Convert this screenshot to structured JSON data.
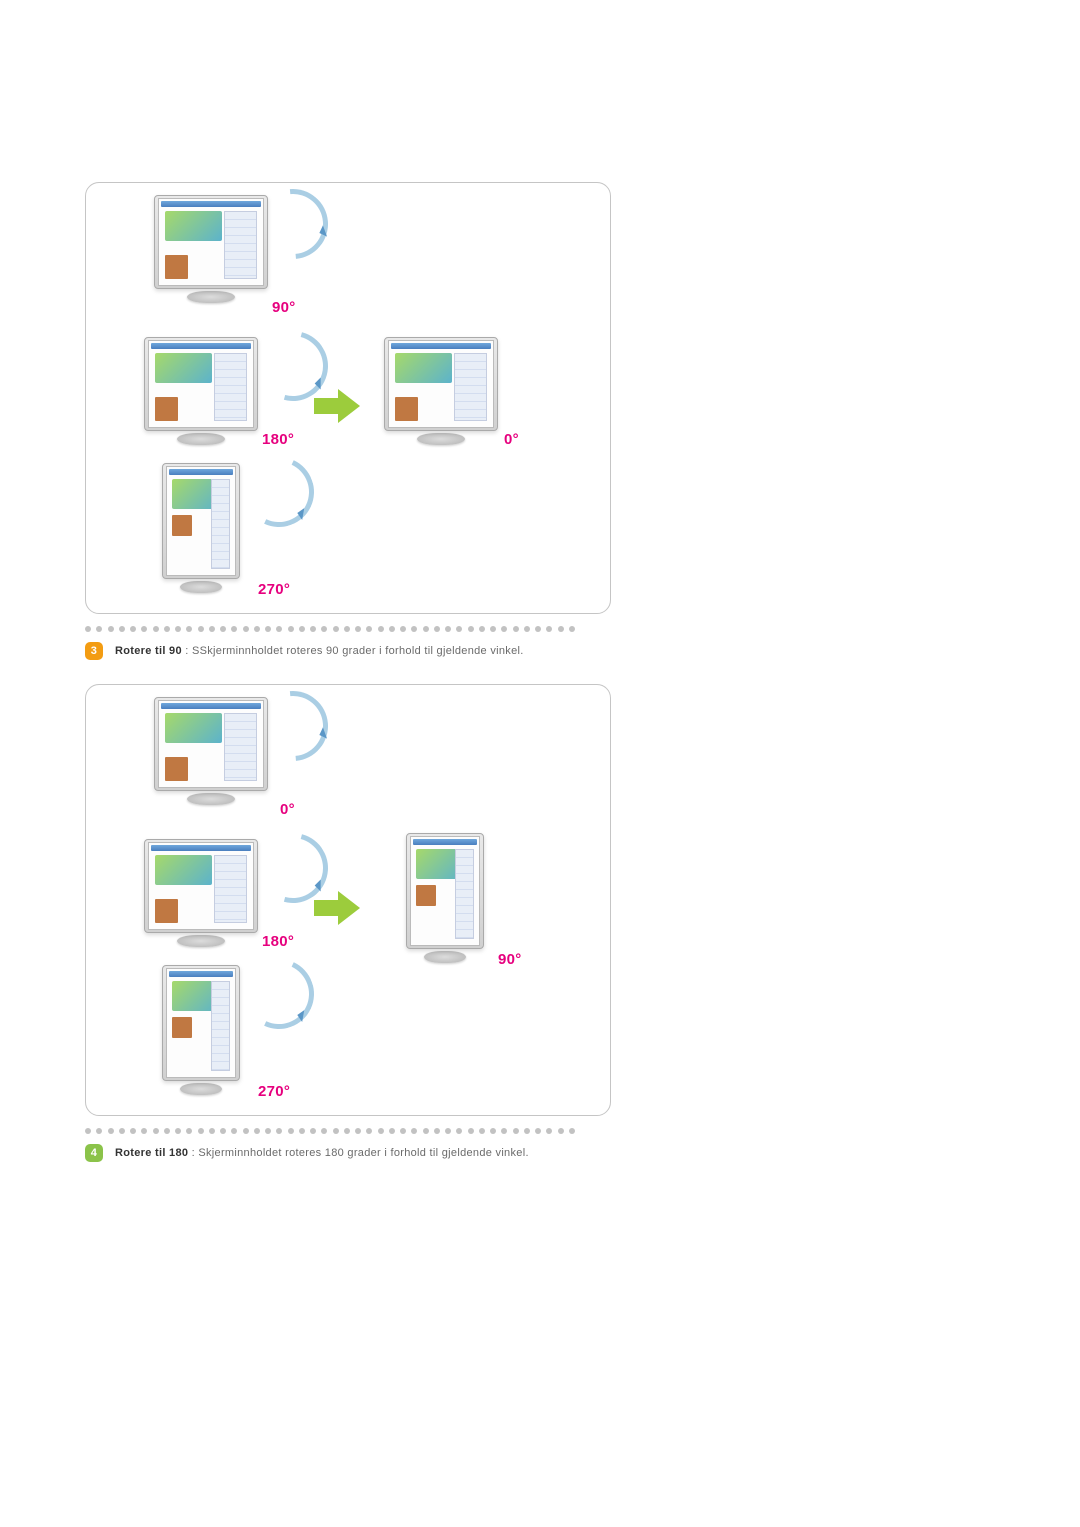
{
  "sections": {
    "s3": {
      "badge": "3",
      "title": "Rotere til 90",
      "desc": "SSkjerminnholdet roteres 90 grader i forhold til gjeldende vinkel.",
      "labels": {
        "a90": "90°",
        "a180": "180°",
        "a270": "270°",
        "a0": "0°"
      }
    },
    "s4": {
      "badge": "4",
      "title": "Rotere til 180",
      "desc": "Skjerminnholdet roteres 180 grader i forhold til gjeldende vinkel.",
      "labels": {
        "a0": "0°",
        "a180": "180°",
        "a270": "270°",
        "a90": "90°"
      }
    }
  }
}
